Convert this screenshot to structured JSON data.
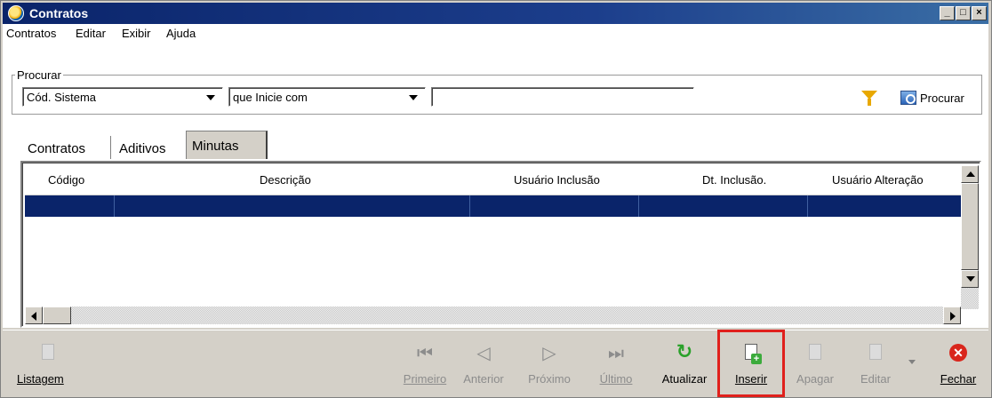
{
  "window": {
    "title": "Contratos",
    "controls": [
      "_",
      "□",
      "×"
    ]
  },
  "menu": [
    "Contratos",
    "Editar",
    "Exibir",
    "Ajuda"
  ],
  "search": {
    "group_label": "Procurar",
    "field_value": "Cód. Sistema",
    "operator_value": "que Inicie com",
    "text_value": "",
    "search_button": "Procurar"
  },
  "tabs": [
    "Contratos",
    "Aditivos",
    "Minutas"
  ],
  "active_tab": "Minutas",
  "grid": {
    "columns": [
      "Código",
      "Descrição",
      "Usuário Inclusão",
      "Dt. Inclusão.",
      "Usuário Alteração"
    ],
    "rows": []
  },
  "toolbar": {
    "listagem": "Listagem",
    "primeiro": "Primeiro",
    "anterior": "Anterior",
    "proximo": "Próximo",
    "ultimo": "Último",
    "atualizar": "Atualizar",
    "inserir": "Inserir",
    "apagar": "Apagar",
    "editar": "Editar",
    "fechar": "Fechar"
  },
  "colors": {
    "titlebar": "#0a246a",
    "selection": "#0a246a",
    "highlight": "#e0201c"
  }
}
